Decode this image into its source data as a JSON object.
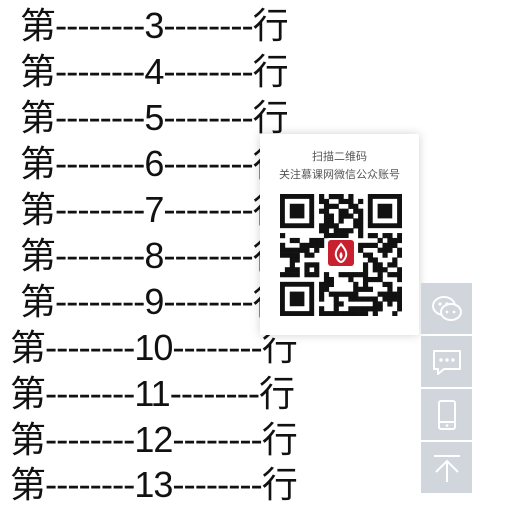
{
  "rows": [
    {
      "prefix": "第",
      "dashes1": "--------",
      "num": "3",
      "dashes2": "--------",
      "suffix": "行"
    },
    {
      "prefix": "第",
      "dashes1": "--------",
      "num": "4",
      "dashes2": "--------",
      "suffix": "行"
    },
    {
      "prefix": "第",
      "dashes1": "--------",
      "num": "5",
      "dashes2": "--------",
      "suffix": "行"
    },
    {
      "prefix": "第",
      "dashes1": "--------",
      "num": "6",
      "dashes2": "--------",
      "suffix": "行"
    },
    {
      "prefix": "第",
      "dashes1": "--------",
      "num": "7",
      "dashes2": "--------",
      "suffix": "行"
    },
    {
      "prefix": "第",
      "dashes1": "--------",
      "num": "8",
      "dashes2": "--------",
      "suffix": "行"
    },
    {
      "prefix": "第",
      "dashes1": "--------",
      "num": "9",
      "dashes2": "--------",
      "suffix": "行"
    },
    {
      "prefix": "第",
      "dashes1": "--------",
      "num": "10",
      "dashes2": "--------",
      "suffix": "行"
    },
    {
      "prefix": "第",
      "dashes1": "--------",
      "num": "11",
      "dashes2": "--------",
      "suffix": "行"
    },
    {
      "prefix": "第",
      "dashes1": "--------",
      "num": "12",
      "dashes2": "--------",
      "suffix": "行"
    },
    {
      "prefix": "第",
      "dashes1": "--------",
      "num": "13",
      "dashes2": "--------",
      "suffix": "行"
    }
  ],
  "qr_popup": {
    "line1": "扫描二维码",
    "line2": "关注慕课网微信公众账号"
  },
  "sidebar": {
    "buttons": [
      {
        "icon": "wechat-icon"
      },
      {
        "icon": "chat-bubble-icon"
      },
      {
        "icon": "mobile-phone-icon"
      },
      {
        "icon": "back-to-top-icon"
      }
    ]
  }
}
